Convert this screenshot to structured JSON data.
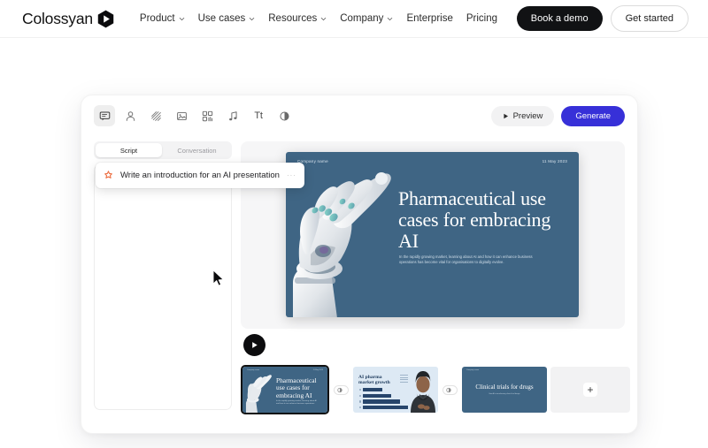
{
  "navbar": {
    "brand": "Colossyan",
    "links": [
      {
        "label": "Product",
        "caret": true
      },
      {
        "label": "Use cases",
        "caret": true
      },
      {
        "label": "Resources",
        "caret": true
      },
      {
        "label": "Company",
        "caret": true
      },
      {
        "label": "Enterprise",
        "caret": false
      },
      {
        "label": "Pricing",
        "caret": false
      }
    ],
    "book_demo": "Book a demo",
    "get_started": "Get started"
  },
  "toolbar": {
    "icons": [
      {
        "name": "script-bubble-icon",
        "active": true
      },
      {
        "name": "avatar-person-icon",
        "active": false
      },
      {
        "name": "background-pattern-icon",
        "active": false
      },
      {
        "name": "image-icon",
        "active": false
      },
      {
        "name": "template-layout-icon",
        "active": false
      },
      {
        "name": "music-note-icon",
        "active": false
      },
      {
        "name": "text-icon",
        "label": "Tt",
        "active": false
      },
      {
        "name": "contrast-circle-icon",
        "active": false
      }
    ],
    "preview_label": "Preview",
    "generate_label": "Generate",
    "generate_color": "#3730d8"
  },
  "script_panel": {
    "tabs": [
      {
        "label": "Script",
        "active": true
      },
      {
        "label": "Conversation",
        "active": false
      }
    ],
    "prompt": {
      "text": "Write an introduction for an AI presentation",
      "icon": "ai-sparkle-icon",
      "icon_color": "#ec6a3c",
      "trailing": "···"
    }
  },
  "stage": {
    "slide": {
      "company": "Company name",
      "date": "11 May 2023",
      "title": "Pharmaceutical use cases for embracing AI",
      "body": "In the rapidly growing market, learning about AI and how it can enhance business operations has become vital for organisations to digitally evolve.",
      "bg_color": "#3f6584",
      "illustration": "robot-hand-image"
    },
    "play_button": "play-icon"
  },
  "timeline": {
    "slides": [
      {
        "name": "slide-1",
        "selected": true,
        "company": "Company name",
        "date": "11 May 2023",
        "title": "Pharmaceutical use cases for embracing AI",
        "sub": "In the rapidly growing market, learning about AI and how it can enhance business operations.",
        "bg_color": "#3f6584"
      },
      {
        "name": "slide-2",
        "selected": false,
        "title": "AI pharma market growth",
        "bg_color": "#dde9f4",
        "chart_bars": [
          22,
          32,
          42,
          52
        ]
      },
      {
        "name": "slide-3",
        "selected": false,
        "company": "Company name",
        "title": "Clinical trials for drugs",
        "sub": "How AI is transforming clinical trial design",
        "bg_color": "#3f6584"
      }
    ],
    "transition_label": "transition-icon",
    "add_label": "+"
  }
}
